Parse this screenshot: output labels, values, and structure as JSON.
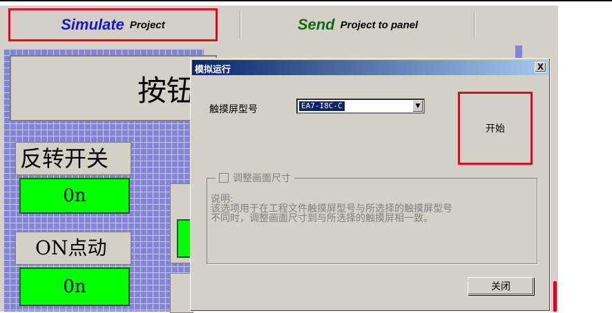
{
  "toolbar": {
    "simulate_big": "Simulate",
    "simulate_small": "Project",
    "send_big": "Send",
    "send_small": "Project to panel"
  },
  "canvas": {
    "title": "按钮",
    "reverse_switch_label": "反转开关",
    "reverse_switch_button": "0n",
    "on_jog_label": "ON点动",
    "on_jog_button": "0n"
  },
  "dialog": {
    "title": "模拟运行",
    "close_glyph": "X",
    "model_label": "触摸屏型号",
    "model_value": "EA7-I8C-C",
    "start_button": "开始",
    "resize_checkbox_label": "调整画面尺寸",
    "description": "说明:\n该选项用于在工程文件触摸屏型号与所选择的触摸屏型号\n不同时，调整画面尺寸到与所选择的触摸屏相一致。",
    "close_button": "关闭"
  },
  "colors": {
    "accent_red": "#e8001c",
    "simulate_blue": "#1515d0",
    "send_green": "#0f6b1a",
    "button_green": "#00ff00",
    "grid_blue": "#8284d6"
  },
  "icons": {
    "dropdown": "chevron-down-icon",
    "close": "close-icon",
    "checkbox": "checkbox-icon"
  }
}
